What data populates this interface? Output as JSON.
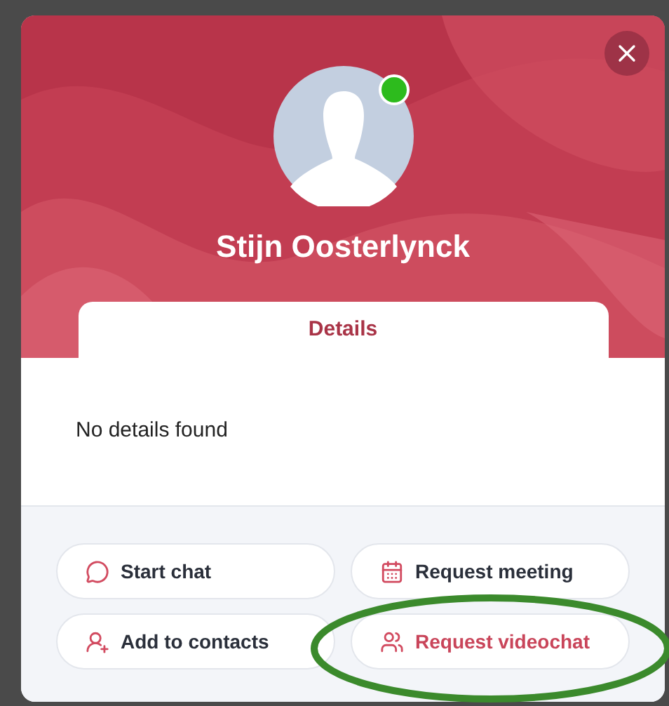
{
  "profile": {
    "name": "Stijn Oosterlynck",
    "online": true
  },
  "tabs": [
    {
      "label": "Details",
      "selected": true
    }
  ],
  "details": {
    "empty_message": "No details found"
  },
  "actions": [
    {
      "kind": "chat",
      "label": "Start chat",
      "highlighted": false
    },
    {
      "kind": "meeting",
      "label": "Request meeting",
      "highlighted": false
    },
    {
      "kind": "contact",
      "label": "Add to contacts",
      "highlighted": false
    },
    {
      "kind": "video",
      "label": "Request videochat",
      "highlighted": true
    }
  ]
}
